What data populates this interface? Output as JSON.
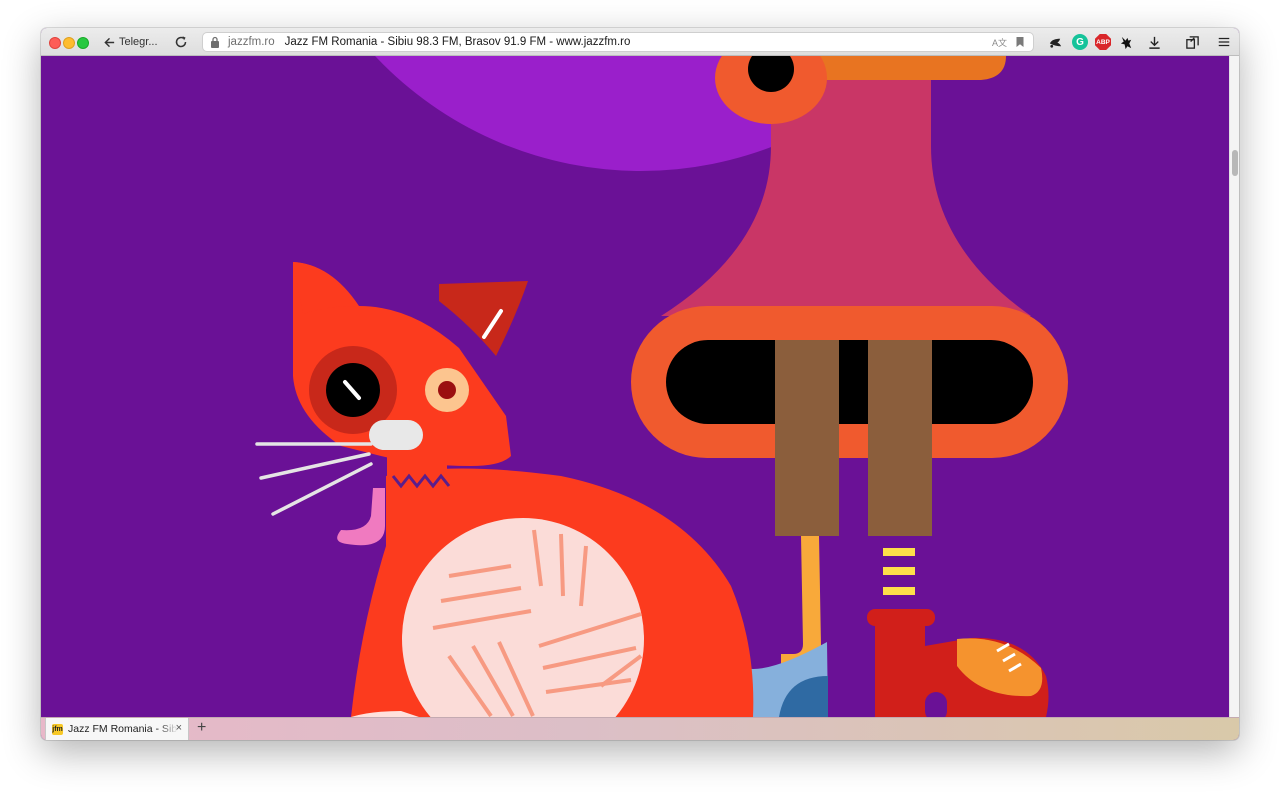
{
  "toolbar": {
    "back_label": "Telegr...",
    "url_domain": "jazzfm.ro",
    "page_title": "Jazz FM Romania - Sibiu 98.3 FM, Brasov 91.9 FM - www.jazzfm.ro",
    "extensions": [
      "pocket-icon",
      "grammarly-icon",
      "adblock-plus-icon",
      "bat-extension-icon",
      "downloads-icon",
      "synced-tabs-icon",
      "menu-icon"
    ],
    "grammarly_glyph": "G",
    "abp_glyph": "ABP",
    "reader_glyph": "A文"
  },
  "tabs": {
    "active_label": "Jazz FM Romania - Sibiu",
    "favicon_glyph": "jfm",
    "close_glyph": "×",
    "new_tab_glyph": "+"
  },
  "colors": {
    "background": "#6a1196",
    "moon": "#9a1fcb",
    "cat": "#fc3b1e",
    "nose": "#f05a2e",
    "horn": "#c93666",
    "yarn": "#fbdcd8",
    "shoe_blue": "#86b0dc",
    "boot_red": "#d11f1a"
  }
}
